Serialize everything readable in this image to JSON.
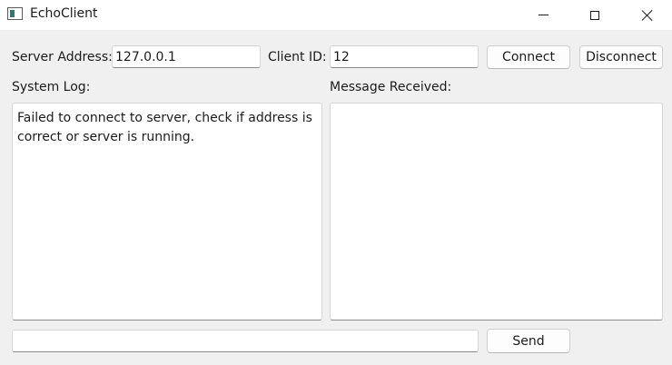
{
  "window": {
    "title": "EchoClient",
    "icon": "app-window-icon",
    "controls": {
      "minimize_icon": "minimize-icon",
      "maximize_icon": "maximize-icon",
      "close_icon": "close-icon"
    }
  },
  "connection": {
    "server_address_label": "Server Address:",
    "server_address_value": "127.0.0.1",
    "client_id_label": "Client ID:",
    "client_id_value": "12",
    "connect_label": "Connect",
    "disconnect_label": "Disconnect"
  },
  "system_log": {
    "label": "System Log:",
    "text": "Failed to connect to server, check if address is correct or server is running."
  },
  "messages": {
    "label": "Message Received:",
    "text": ""
  },
  "compose": {
    "value": "",
    "send_label": "Send"
  }
}
